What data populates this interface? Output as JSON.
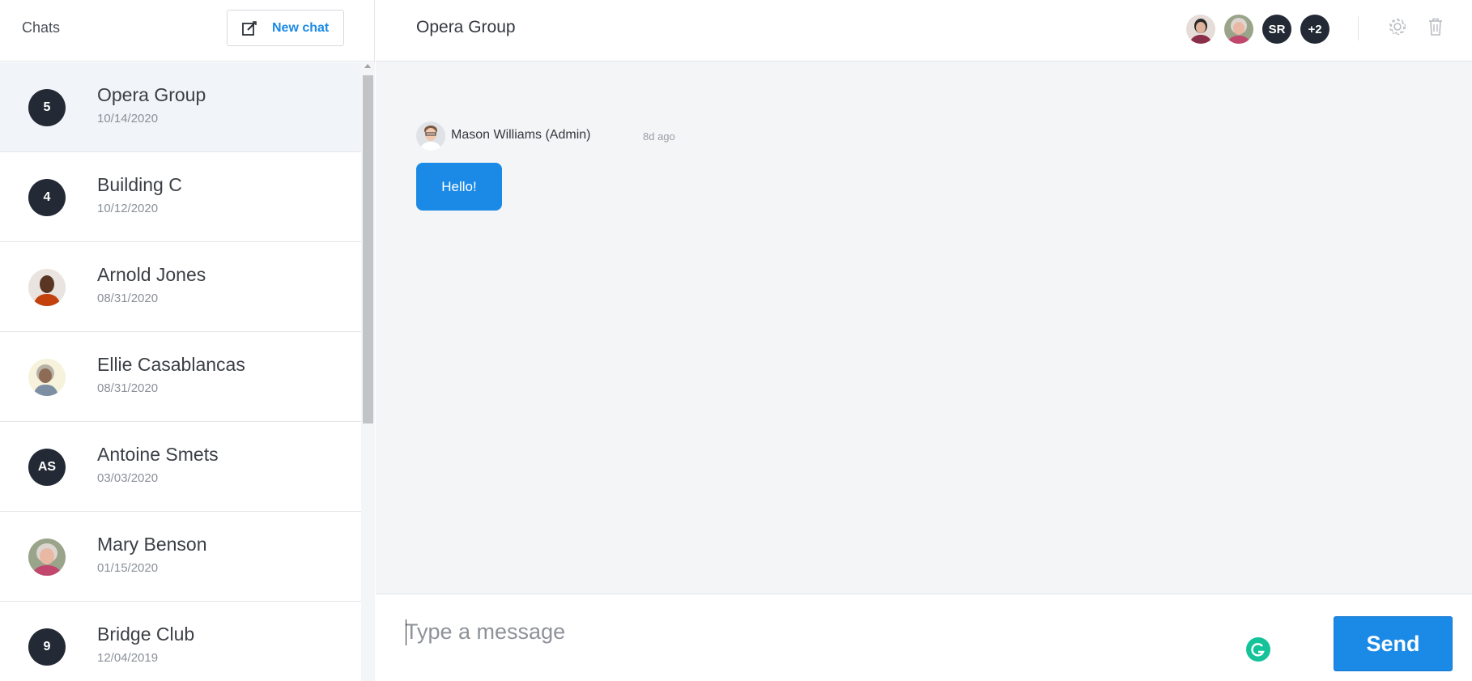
{
  "sidebar": {
    "title": "Chats",
    "new_chat_label": "New chat",
    "chats": [
      {
        "name": "Opera Group",
        "date": "10/14/2020",
        "badge": "5",
        "active": true
      },
      {
        "name": "Building C",
        "date": "10/12/2020",
        "badge": "4"
      },
      {
        "name": "Arnold Jones",
        "date": "08/31/2020",
        "avatar_icon": "person-photo-avatar"
      },
      {
        "name": "Ellie Casablancas",
        "date": "08/31/2020",
        "avatar_icon": "person-photo-avatar"
      },
      {
        "name": "Antoine Smets",
        "date": "03/03/2020",
        "badge": "AS"
      },
      {
        "name": "Mary Benson",
        "date": "01/15/2020",
        "avatar_icon": "person-photo-avatar"
      },
      {
        "name": "Bridge Club",
        "date": "12/04/2019",
        "badge": "9"
      }
    ]
  },
  "conversation": {
    "title": "Opera Group",
    "members": [
      {
        "avatar_icon": "person-photo-avatar"
      },
      {
        "avatar_icon": "person-photo-avatar"
      },
      {
        "initials": "SR"
      },
      {
        "initials": "+2"
      }
    ],
    "settings_icon": "gear-icon",
    "delete_icon": "trash-icon",
    "messages": [
      {
        "author": "Mason Williams (Admin)",
        "time": "8d ago",
        "text": "Hello!"
      }
    ]
  },
  "composer": {
    "placeholder": "Type a message",
    "send_label": "Send"
  },
  "colors": {
    "accent": "#1b8ae6",
    "badge_bg": "#232a35",
    "active_row": "#f1f5fa",
    "canvas": "#f4f5f7"
  }
}
